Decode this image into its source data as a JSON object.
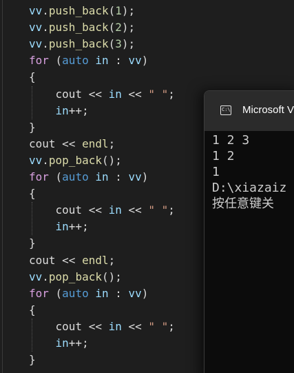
{
  "code": {
    "lines": [
      {
        "tokens": [
          {
            "c": "tk-var",
            "t": "vv"
          },
          {
            "c": "tk-punct",
            "t": "."
          },
          {
            "c": "tk-fn",
            "t": "push_back"
          },
          {
            "c": "tk-punct",
            "t": "("
          },
          {
            "c": "tk-num",
            "t": "1"
          },
          {
            "c": "tk-punct",
            "t": ");"
          }
        ]
      },
      {
        "tokens": [
          {
            "c": "tk-var",
            "t": "vv"
          },
          {
            "c": "tk-punct",
            "t": "."
          },
          {
            "c": "tk-fn",
            "t": "push_back"
          },
          {
            "c": "tk-punct",
            "t": "("
          },
          {
            "c": "tk-num",
            "t": "2"
          },
          {
            "c": "tk-punct",
            "t": ");"
          }
        ]
      },
      {
        "tokens": [
          {
            "c": "tk-var",
            "t": "vv"
          },
          {
            "c": "tk-punct",
            "t": "."
          },
          {
            "c": "tk-fn",
            "t": "push_back"
          },
          {
            "c": "tk-punct",
            "t": "("
          },
          {
            "c": "tk-num",
            "t": "3"
          },
          {
            "c": "tk-punct",
            "t": ");"
          }
        ]
      },
      {
        "tokens": [
          {
            "c": "tk-kwctrl",
            "t": "for"
          },
          {
            "c": "tk-punct",
            "t": " ("
          },
          {
            "c": "tk-kw",
            "t": "auto"
          },
          {
            "c": "tk-punct",
            "t": " "
          },
          {
            "c": "tk-var",
            "t": "in"
          },
          {
            "c": "tk-punct",
            "t": " : "
          },
          {
            "c": "tk-var",
            "t": "vv"
          },
          {
            "c": "tk-punct",
            "t": ")"
          }
        ]
      },
      {
        "tokens": [
          {
            "c": "tk-punct",
            "t": "{"
          }
        ]
      },
      {
        "tokens": [
          {
            "c": "tk-punct",
            "t": "    "
          },
          {
            "c": "tk-punct",
            "t": "cout"
          },
          {
            "c": "tk-op",
            "t": " << "
          },
          {
            "c": "tk-var",
            "t": "in"
          },
          {
            "c": "tk-op",
            "t": " << "
          },
          {
            "c": "tk-str",
            "t": "\" \""
          },
          {
            "c": "tk-punct",
            "t": ";"
          }
        ]
      },
      {
        "tokens": [
          {
            "c": "tk-punct",
            "t": "    "
          },
          {
            "c": "tk-var",
            "t": "in"
          },
          {
            "c": "tk-op",
            "t": "++"
          },
          {
            "c": "tk-punct",
            "t": ";"
          }
        ]
      },
      {
        "tokens": [
          {
            "c": "tk-punct",
            "t": "}"
          }
        ]
      },
      {
        "tokens": [
          {
            "c": "tk-punct",
            "t": "cout"
          },
          {
            "c": "tk-op",
            "t": " << "
          },
          {
            "c": "tk-fn",
            "t": "endl"
          },
          {
            "c": "tk-punct",
            "t": ";"
          }
        ]
      },
      {
        "tokens": [
          {
            "c": "tk-var",
            "t": "vv"
          },
          {
            "c": "tk-punct",
            "t": "."
          },
          {
            "c": "tk-fn",
            "t": "pop_back"
          },
          {
            "c": "tk-punct",
            "t": "();"
          }
        ]
      },
      {
        "tokens": [
          {
            "c": "tk-kwctrl",
            "t": "for"
          },
          {
            "c": "tk-punct",
            "t": " ("
          },
          {
            "c": "tk-kw",
            "t": "auto"
          },
          {
            "c": "tk-punct",
            "t": " "
          },
          {
            "c": "tk-var",
            "t": "in"
          },
          {
            "c": "tk-punct",
            "t": " : "
          },
          {
            "c": "tk-var",
            "t": "vv"
          },
          {
            "c": "tk-punct",
            "t": ")"
          }
        ]
      },
      {
        "tokens": [
          {
            "c": "tk-punct",
            "t": "{"
          }
        ]
      },
      {
        "tokens": [
          {
            "c": "tk-punct",
            "t": "    "
          },
          {
            "c": "tk-punct",
            "t": "cout"
          },
          {
            "c": "tk-op",
            "t": " << "
          },
          {
            "c": "tk-var",
            "t": "in"
          },
          {
            "c": "tk-op",
            "t": " << "
          },
          {
            "c": "tk-str",
            "t": "\" \""
          },
          {
            "c": "tk-punct",
            "t": ";"
          }
        ]
      },
      {
        "tokens": [
          {
            "c": "tk-punct",
            "t": "    "
          },
          {
            "c": "tk-var",
            "t": "in"
          },
          {
            "c": "tk-op",
            "t": "++"
          },
          {
            "c": "tk-punct",
            "t": ";"
          }
        ]
      },
      {
        "tokens": [
          {
            "c": "tk-punct",
            "t": "}"
          }
        ]
      },
      {
        "tokens": [
          {
            "c": "tk-punct",
            "t": "cout"
          },
          {
            "c": "tk-op",
            "t": " << "
          },
          {
            "c": "tk-fn",
            "t": "endl"
          },
          {
            "c": "tk-punct",
            "t": ";"
          }
        ]
      },
      {
        "tokens": [
          {
            "c": "tk-var",
            "t": "vv"
          },
          {
            "c": "tk-punct",
            "t": "."
          },
          {
            "c": "tk-fn",
            "t": "pop_back"
          },
          {
            "c": "tk-punct",
            "t": "();"
          }
        ]
      },
      {
        "tokens": [
          {
            "c": "tk-kwctrl",
            "t": "for"
          },
          {
            "c": "tk-punct",
            "t": " ("
          },
          {
            "c": "tk-kw",
            "t": "auto"
          },
          {
            "c": "tk-punct",
            "t": " "
          },
          {
            "c": "tk-var",
            "t": "in"
          },
          {
            "c": "tk-punct",
            "t": " : "
          },
          {
            "c": "tk-var",
            "t": "vv"
          },
          {
            "c": "tk-punct",
            "t": ")"
          }
        ]
      },
      {
        "tokens": [
          {
            "c": "tk-punct",
            "t": "{"
          }
        ]
      },
      {
        "tokens": [
          {
            "c": "tk-punct",
            "t": "    "
          },
          {
            "c": "tk-punct",
            "t": "cout"
          },
          {
            "c": "tk-op",
            "t": " << "
          },
          {
            "c": "tk-var",
            "t": "in"
          },
          {
            "c": "tk-op",
            "t": " << "
          },
          {
            "c": "tk-str",
            "t": "\" \""
          },
          {
            "c": "tk-punct",
            "t": ";"
          }
        ]
      },
      {
        "tokens": [
          {
            "c": "tk-punct",
            "t": "    "
          },
          {
            "c": "tk-var",
            "t": "in"
          },
          {
            "c": "tk-op",
            "t": "++"
          },
          {
            "c": "tk-punct",
            "t": ";"
          }
        ]
      },
      {
        "tokens": [
          {
            "c": "tk-punct",
            "t": "}"
          }
        ]
      }
    ]
  },
  "terminal": {
    "icon_text": "C:\\",
    "title": "Microsoft V",
    "output_lines": [
      "1 2 3",
      "1 2",
      "1",
      "D:\\xiazaiz",
      "按任意键关"
    ]
  },
  "colors": {
    "editor_bg": "#1e1e1e",
    "terminal_bg": "#0c0c0c",
    "terminal_titlebar": "#2b2b2b"
  },
  "icons": {
    "terminal_icon": "console-window-icon"
  }
}
